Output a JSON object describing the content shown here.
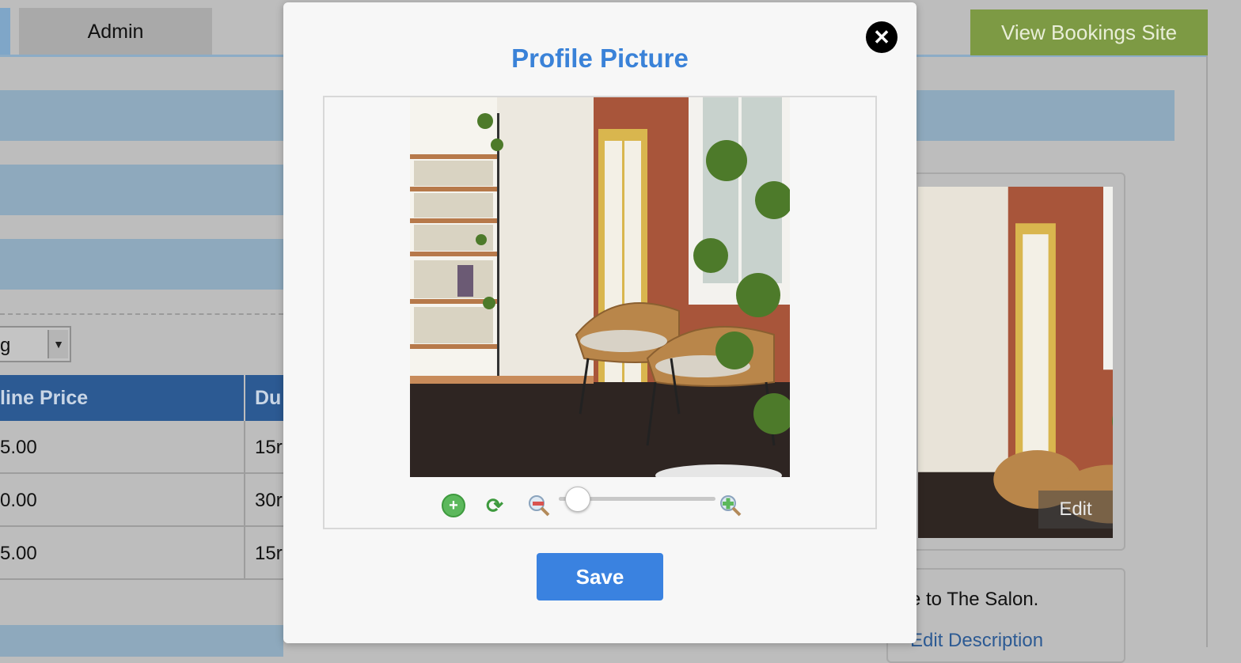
{
  "header": {
    "admin_tab": "Admin",
    "view_bookings_button": "View Bookings Site"
  },
  "background_page": {
    "select_value": "g",
    "table": {
      "headers": [
        "line Price",
        "Du"
      ],
      "rows": [
        [
          "5.00",
          "15r"
        ],
        [
          "0.00",
          "30r"
        ],
        [
          "5.00",
          "15r"
        ]
      ]
    },
    "image_edit_label": "Edit",
    "description_text": "e to The Salon.",
    "edit_description_link": "Edit Description"
  },
  "modal": {
    "title": "Profile Picture",
    "close_icon": "close-icon",
    "save_label": "Save",
    "zoom_level": 0.05,
    "tools": [
      "add-photo-icon",
      "rotate-icon",
      "zoom-out-icon",
      "zoom-in-icon"
    ]
  },
  "colors": {
    "accent_blue": "#3a82d8",
    "save_blue": "#3a82e0",
    "view_bookings_green": "#7d9a44",
    "table_header_blue": "#2c5a93"
  }
}
